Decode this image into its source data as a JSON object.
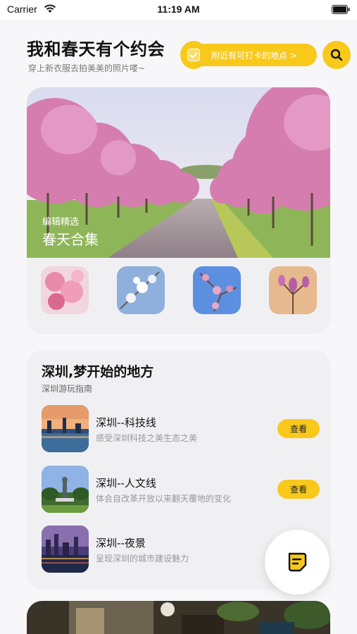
{
  "status_bar": {
    "carrier": "Carrier",
    "time": "11:19 AM"
  },
  "header": {
    "title": "我和春天有个约会",
    "subtitle": "穿上新衣服去拍美美的照片喽~",
    "nearby_label": "附近有可打卡的地点 >"
  },
  "hero": {
    "tag": "编辑精选",
    "title": "春天合集",
    "thumbnails": [
      "cherry-blossom-photo",
      "white-blossom-photo",
      "blue-sky-blossom-photo",
      "magnolia-photo"
    ]
  },
  "guide": {
    "title": "深圳,梦开始的地方",
    "subtitle": "深圳游玩指南",
    "routes": [
      {
        "name": "深圳--科技线",
        "desc": "感受深圳科技之美生态之美",
        "button": "查看"
      },
      {
        "name": "深圳--人文线",
        "desc": "体会自改革开放以来翻天覆地的变化",
        "button": "查看"
      },
      {
        "name": "深圳--夜景",
        "desc": "呈现深圳的城市建设魅力",
        "button": ""
      }
    ]
  },
  "colors": {
    "accent": "#f8c91b",
    "background": "#f7f7f9",
    "card": "#f0f0f3"
  }
}
